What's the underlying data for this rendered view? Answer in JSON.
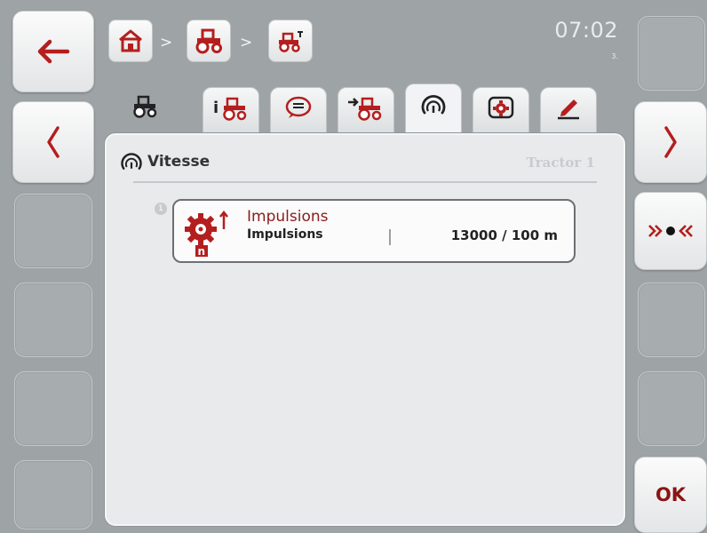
{
  "header": {
    "clock": "07:02",
    "clock_sub": "3."
  },
  "breadcrumb": {
    "separator": ">",
    "items": [
      "home-icon",
      "tractor-icon",
      "tractor-settings-icon"
    ]
  },
  "tabs": [
    {
      "icon": "tractor-outline-icon",
      "active": false
    },
    {
      "icon": "tractor-info-icon",
      "active": false
    },
    {
      "icon": "message-icon",
      "active": false
    },
    {
      "icon": "tractor-hitch-icon",
      "active": false
    },
    {
      "icon": "speedometer-icon",
      "active": true
    },
    {
      "icon": "pto-gear-icon",
      "active": false
    },
    {
      "icon": "edit-pen-icon",
      "active": false
    }
  ],
  "panel": {
    "icon": "speedometer-icon",
    "title": "Vitesse",
    "subtitle": "Tractor 1"
  },
  "items": [
    {
      "index": "1",
      "icon": "impulse-gear-icon",
      "title": "Impulsions",
      "label": "Impulsions",
      "value": "13000 / 100 m"
    }
  ],
  "left_buttons": [
    {
      "icon": "back-arrow-icon",
      "enabled": true
    },
    {
      "icon": "chevron-left-icon",
      "enabled": true
    },
    {
      "enabled": false
    },
    {
      "enabled": false
    },
    {
      "enabled": false
    },
    {
      "enabled": false
    }
  ],
  "right_buttons": [
    {
      "enabled": false
    },
    {
      "icon": "chevron-right-icon",
      "enabled": true
    },
    {
      "icon": "reset-default-icon",
      "enabled": true
    },
    {
      "enabled": false
    },
    {
      "enabled": false
    },
    {
      "label": "OK",
      "enabled": true
    }
  ],
  "colors": {
    "brand_red": "#b41e1e",
    "background": "#9ea3a6",
    "panel": "#e8eaeb"
  }
}
